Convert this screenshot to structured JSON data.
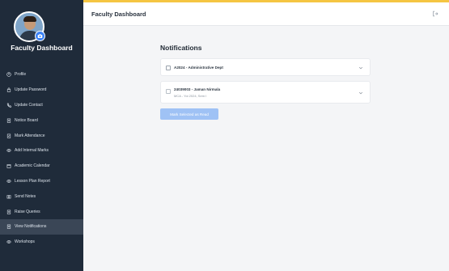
{
  "sidebar": {
    "title": "Faculty Dashboard",
    "items": [
      {
        "label": "Profile",
        "icon": "user-circle-icon",
        "active": false
      },
      {
        "label": "Update Password",
        "icon": "lock-icon",
        "active": false
      },
      {
        "label": "Update Contact",
        "icon": "phone-icon",
        "active": false
      },
      {
        "label": "Notice Board",
        "icon": "clipboard-icon",
        "active": false
      },
      {
        "label": "Mark Attendance",
        "icon": "checklist-icon",
        "active": false
      },
      {
        "label": "Add Internal Marks",
        "icon": "eye-icon",
        "active": false
      },
      {
        "label": "Academic Calendar",
        "icon": "calendar-icon",
        "active": false
      },
      {
        "label": "Lesson Plan Report",
        "icon": "eye-icon",
        "active": false
      },
      {
        "label": "Send Notes",
        "icon": "book-icon",
        "active": false
      },
      {
        "label": "Raise Queries",
        "icon": "clipboard-icon",
        "active": false
      },
      {
        "label": "View Notifications",
        "icon": "clipboard-icon",
        "active": true
      },
      {
        "label": "Workshops",
        "icon": "eye-icon",
        "active": false
      }
    ]
  },
  "header": {
    "title": "Faculty Dashboard"
  },
  "main": {
    "section_title": "Notifications",
    "notifications": [
      {
        "title": "A2024 - Administrative Dept",
        "subtitle": ""
      },
      {
        "title": "24039003 - Jaman Nirmala",
        "subtitle": "MCA - Yoi 2024, Sem I"
      }
    ],
    "mark_button_label": "Mark Selected as Read"
  },
  "colors": {
    "sidebar_bg": "#1f2b3a",
    "accent": "#f5c542",
    "button_disabled": "#9fc2f5"
  }
}
